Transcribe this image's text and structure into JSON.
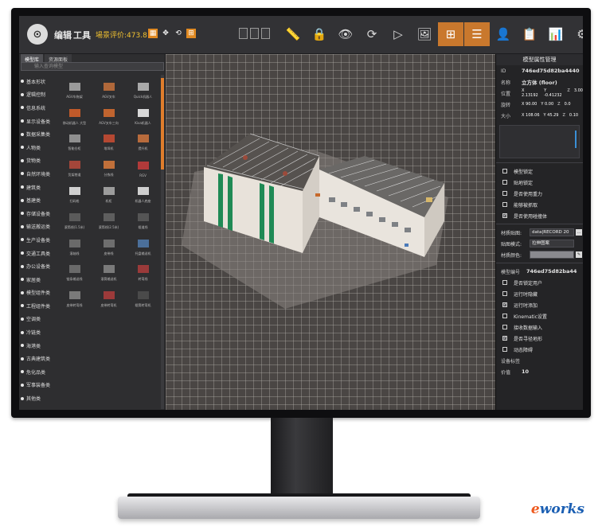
{
  "app": {
    "logo_glyph": "⊙",
    "menu": [
      "编辑",
      "工具"
    ],
    "score": "場景评价:473.8",
    "small_buttons": [
      "▦",
      "✥",
      "⟲",
      "⊞"
    ],
    "tools": [
      {
        "name": "ruler-icon",
        "glyph": "📏"
      },
      {
        "name": "lock-icon",
        "glyph": "🔒"
      },
      {
        "name": "eye-icon",
        "glyph": "👁"
      },
      {
        "name": "rotate-icon",
        "glyph": "⟳"
      },
      {
        "name": "play-icon",
        "glyph": "▷"
      },
      {
        "name": "image-icon",
        "glyph": "🖼"
      },
      {
        "name": "layout-grid-icon",
        "glyph": "⊞",
        "active": true
      },
      {
        "name": "list-icon",
        "glyph": "☰",
        "active": true
      },
      {
        "name": "person-icon",
        "glyph": "👤"
      },
      {
        "name": "clipboard-icon",
        "glyph": "📋"
      },
      {
        "name": "bar-chart-icon",
        "glyph": "📊"
      },
      {
        "name": "gear-icon",
        "glyph": "⚙"
      },
      {
        "name": "power-icon",
        "glyph": "⏻"
      }
    ]
  },
  "left": {
    "tabs": [
      "模型库",
      "资源面板"
    ],
    "search_placeholder": "输入查询模型",
    "categories": [
      "基本形状",
      "逻辑控制",
      "信息系统",
      "显示设备类",
      "数据采集类",
      "人物类",
      "货物类",
      "自然环境类",
      "建筑类",
      "基建类",
      "存储设备类",
      "输送搬运类",
      "生产设备类",
      "交通工具类",
      "办公设备类",
      "家居类",
      "模型组件类",
      "工程组件类",
      "空调类",
      "冷链类",
      "海港类",
      "古典建筑类",
      "危化品类",
      "军事装备类",
      "其他类"
    ],
    "grid": [
      {
        "label": "AGV车拖架",
        "color": "#9a9a9a"
      },
      {
        "label": "AGV叉车",
        "color": "#b0683a"
      },
      {
        "label": "Quick机器人",
        "color": "#a9a9a9"
      },
      {
        "label": "移动机器人 大型",
        "color": "#c05a2a"
      },
      {
        "label": "AGV叉车三向",
        "color": "#c0642f"
      },
      {
        "label": "Kiva机器人",
        "color": "#d8d8d8"
      },
      {
        "label": "智能仓柜",
        "color": "#8f8f8f"
      },
      {
        "label": "堆垛机",
        "color": "#b54832"
      },
      {
        "label": "提升机",
        "color": "#b86b3c"
      },
      {
        "label": "货架巷道",
        "color": "#a4463a"
      },
      {
        "label": "分拣线",
        "color": "#c1703a"
      },
      {
        "label": "RGV",
        "color": "#b13a3a"
      },
      {
        "label": "扫码枪",
        "color": "#d0d0d0"
      },
      {
        "label": "机柜",
        "color": "#9c9c9c"
      },
      {
        "label": "机器人底座",
        "color": "#cfcfcf"
      },
      {
        "label": "滚筒线(1.5米)",
        "color": "#5a5a5a"
      },
      {
        "label": "滚筒线(2.5米)",
        "color": "#5e5e5e"
      },
      {
        "label": "辊道线",
        "color": "#555555"
      },
      {
        "label": "滚轴线",
        "color": "#6a6a6a"
      },
      {
        "label": "皮带线",
        "color": "#6e6e6e"
      },
      {
        "label": "托盘输送机",
        "color": "#4b6f9a"
      },
      {
        "label": "链条输送线",
        "color": "#6a6a6a"
      },
      {
        "label": "滚筒输送机",
        "color": "#7a7a7a"
      },
      {
        "label": "转弯线",
        "color": "#9a3a3a"
      },
      {
        "label": "皮带转弯线",
        "color": "#7a7a7a"
      },
      {
        "label": "皮带转弯机",
        "color": "#9c3a3a"
      },
      {
        "label": "辊筒转弯机",
        "color": "#4a4a4a"
      }
    ]
  },
  "right": {
    "header": "模型属性管理",
    "id_label": "ID",
    "id_value": "746ed75d82ba4440",
    "name_label": "名称",
    "name_value": "立方体 (floor)",
    "position_label": "位置",
    "position": {
      "x": "X 2.13192",
      "y": "Y -0.41232",
      "z": "Z",
      "zv": "3.00"
    },
    "rotation_label": "旋转",
    "rotation": {
      "x": "X 90.00",
      "y": "Y 0.00",
      "z": "Z",
      "zv": "0.0"
    },
    "size_label": "大小",
    "size": {
      "x": "X 108.06",
      "y": "Y 45.29",
      "z": "Z",
      "zv": "0.10"
    },
    "checks1": [
      {
        "label": "模型锁定",
        "on": false
      },
      {
        "label": "贴地锁定",
        "on": false
      },
      {
        "label": "是否使用重力",
        "on": false
      },
      {
        "label": "能够被抓取",
        "on": false
      },
      {
        "label": "是否使用碰撞体",
        "on": true
      }
    ],
    "texture_label": "材质贴图:",
    "texture_value": "data|RECORD 20",
    "texture_btn": "…",
    "mode_label": "贴图模式:",
    "mode_value": "拉伸图案",
    "color_label": "材质颜色:",
    "color_btn": "✎",
    "model_no_label": "模型编号",
    "model_no_value": "746ed75d82ba44",
    "checks2": [
      {
        "label": "是否锁定用户",
        "on": false
      },
      {
        "label": "运行时隐藏",
        "on": false
      },
      {
        "label": "运行时添加",
        "on": true
      },
      {
        "label": "Kinematic设置",
        "on": false
      },
      {
        "label": "接收数据输入",
        "on": false
      },
      {
        "label": "是否寻径地形",
        "on": true
      },
      {
        "label": "动态障碍",
        "on": false
      }
    ],
    "device_tag_label": "设备标签",
    "value_label": "价值",
    "value_value": "10"
  },
  "watermark": {
    "e": "e",
    "rest": "works"
  }
}
